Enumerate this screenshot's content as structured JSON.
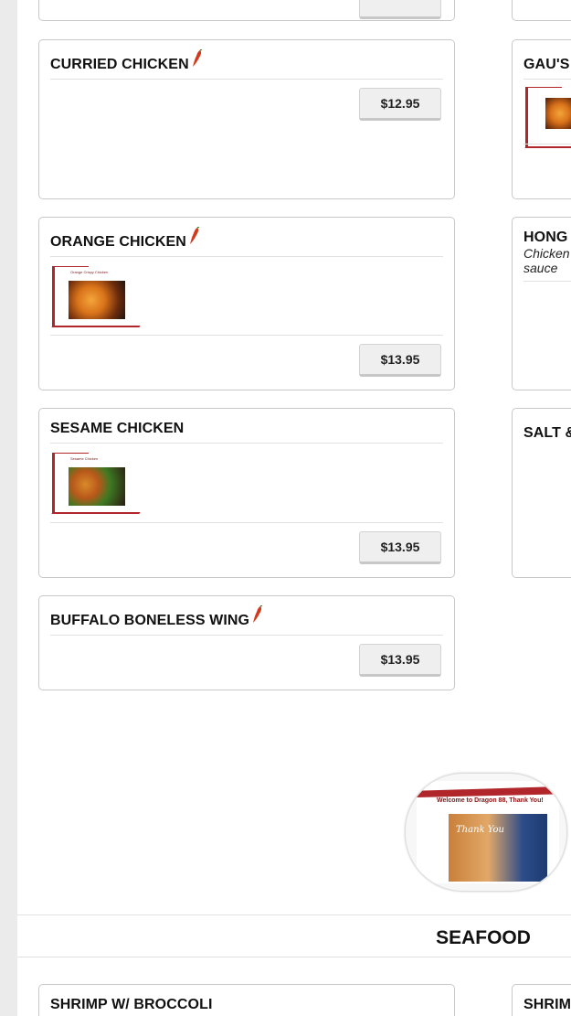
{
  "colors": {
    "accent_red": "#b0262a",
    "border": "#c9c9c9",
    "button_bg": "#efefef"
  },
  "left_items": [
    {
      "name": "CURRIED CHICKEN",
      "price": "$12.95",
      "spicy": true
    },
    {
      "name": "ORANGE CHICKEN",
      "price": "$13.95",
      "spicy": true,
      "thumb_caption": "Orange Crispy Chicken"
    },
    {
      "name": "SESAME CHICKEN",
      "price": "$13.95",
      "spicy": false,
      "thumb_caption": "Sesame Chicken"
    },
    {
      "name": "BUFFALO BONELESS WING",
      "price": "$13.95",
      "spicy": true
    },
    {
      "name": "SHRIMP W/ BROCCOLI"
    }
  ],
  "right_items": [
    {
      "name": "GAU'S"
    },
    {
      "name": "HONG",
      "description": "Chicken sauce"
    },
    {
      "name": "SALT &"
    },
    {
      "name": "SHRIM"
    }
  ],
  "banner": {
    "caption": "Welcome to Dragon 88, Thank You!",
    "photo_text": "Thank You"
  },
  "section": {
    "title": "SEAFOOD"
  },
  "icons": {
    "spicy": "chili-pepper-icon"
  }
}
